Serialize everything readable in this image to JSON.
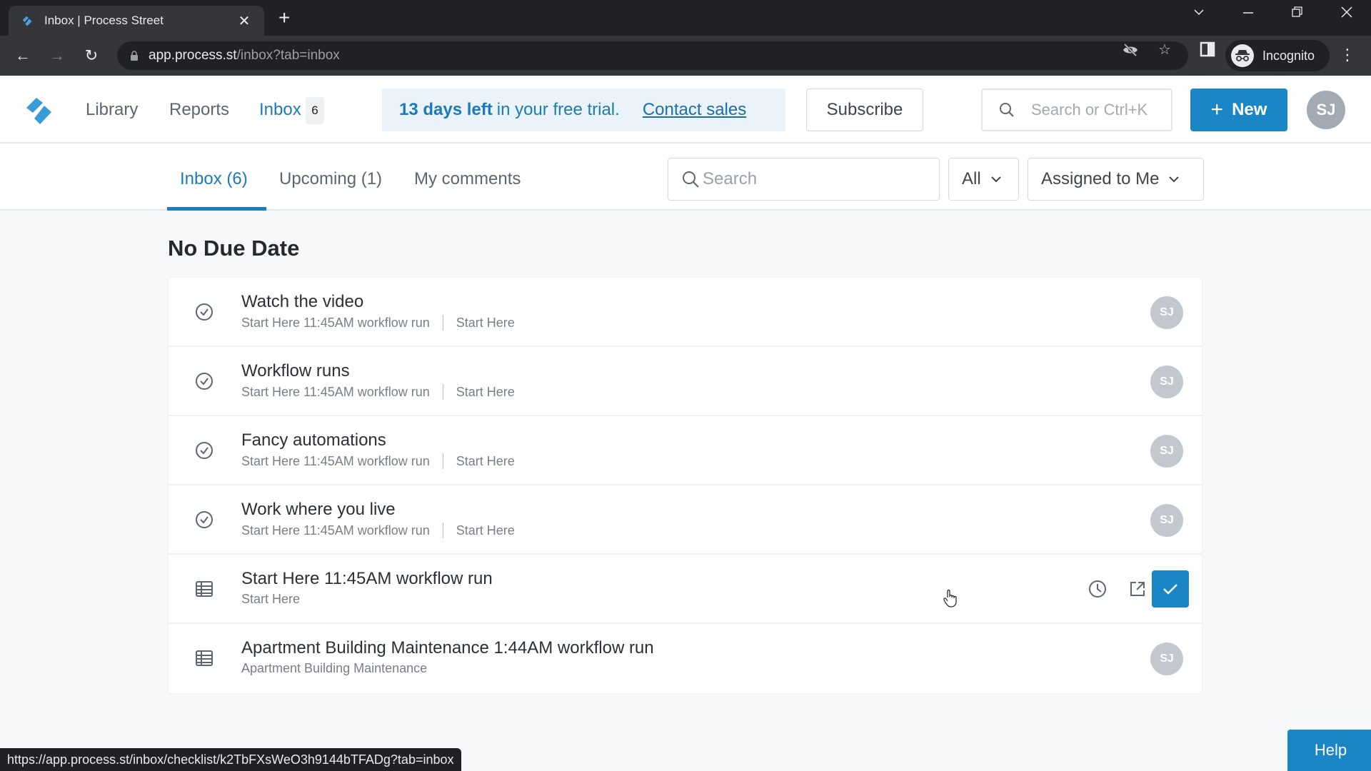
{
  "browser": {
    "tab_title": "Inbox | Process Street",
    "url_host": "app.process.st",
    "url_path": "/inbox?tab=inbox",
    "profile_label": "Incognito",
    "status_url": "https://app.process.st/inbox/checklist/k2TbFXsWeO3h9144bTFADg?tab=inbox"
  },
  "header": {
    "nav": [
      {
        "label": "Library"
      },
      {
        "label": "Reports"
      },
      {
        "label": "Inbox",
        "badge": "6",
        "active": true
      }
    ],
    "trial": {
      "days_left": "13 days left",
      "rest": "in your free trial.",
      "contact_label": "Contact sales"
    },
    "subscribe_label": "Subscribe",
    "search_placeholder": "Search or Ctrl+K",
    "new_label": "New",
    "user_initials": "SJ"
  },
  "subnav": {
    "tabs": [
      {
        "label": "Inbox (6)",
        "active": true
      },
      {
        "label": "Upcoming (1)"
      },
      {
        "label": "My comments"
      }
    ],
    "search_placeholder": "Search",
    "filter_type": "All",
    "filter_assignee": "Assigned to Me"
  },
  "section": {
    "title": "No Due Date"
  },
  "items": [
    {
      "type": "task",
      "title": "Watch the video",
      "run": "Start Here 11:45AM workflow run",
      "workflow": "Start Here",
      "assignee": "SJ"
    },
    {
      "type": "task",
      "title": "Workflow runs",
      "run": "Start Here 11:45AM workflow run",
      "workflow": "Start Here",
      "assignee": "SJ"
    },
    {
      "type": "task",
      "title": "Fancy automations",
      "run": "Start Here 11:45AM workflow run",
      "workflow": "Start Here",
      "assignee": "SJ"
    },
    {
      "type": "task",
      "title": "Work where you live",
      "run": "Start Here 11:45AM workflow run",
      "workflow": "Start Here",
      "assignee": "SJ"
    },
    {
      "type": "workflow-run",
      "title": "Start Here 11:45AM workflow run",
      "workflow": "Start Here",
      "hovered": true
    },
    {
      "type": "workflow-run",
      "title": "Apartment Building Maintenance 1:44AM workflow run",
      "workflow": "Apartment Building Maintenance",
      "assignee": "SJ"
    }
  ],
  "help_label": "Help",
  "colors": {
    "brand": "#1a86c6",
    "link": "#1d7ab8",
    "trial_bg": "#eaf3fa",
    "avatar": "#c2c8ce"
  }
}
